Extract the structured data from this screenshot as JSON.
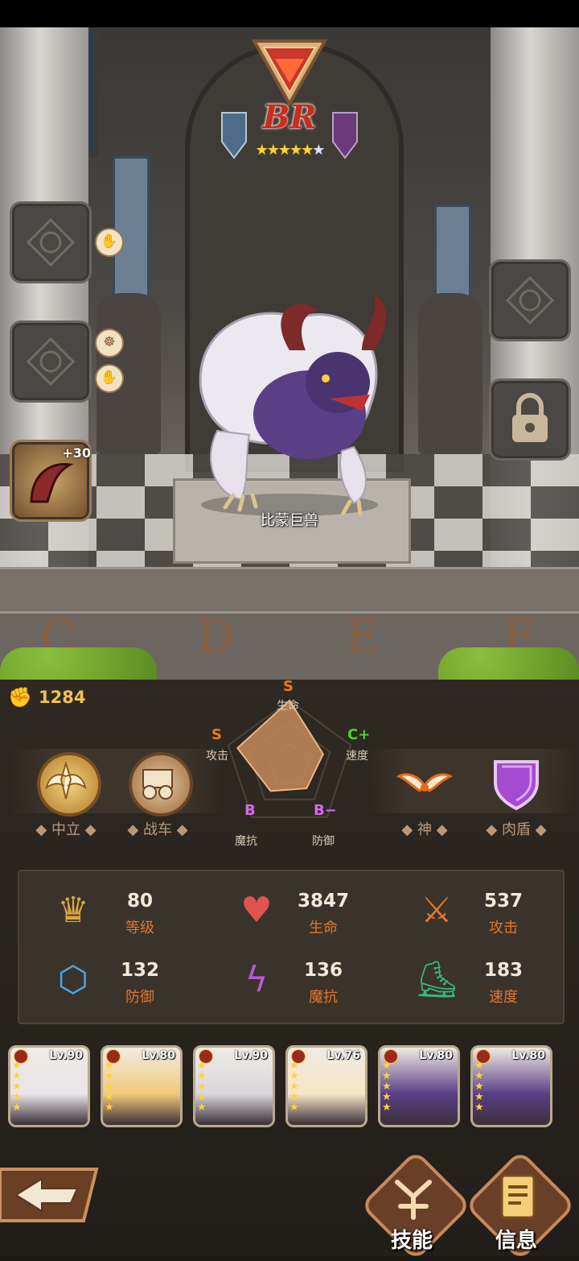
{
  "unit": {
    "rank": "BR",
    "stars_filled": 5,
    "stars_total": 6,
    "name": "比蒙巨兽",
    "buff_bonus": "+30",
    "power": "1284"
  },
  "floor_letters": [
    "C",
    "D",
    "E",
    "F"
  ],
  "traits": [
    {
      "label": "中立",
      "icon": "angel-wings-crest-icon"
    },
    {
      "label": "战车",
      "icon": "chariot-icon"
    },
    {
      "label": "神",
      "icon": "wings-icon"
    },
    {
      "label": "肉盾",
      "icon": "shield-icon"
    }
  ],
  "radar": {
    "axes": [
      {
        "label": "生命",
        "grade": "S",
        "color": "#f07a1c"
      },
      {
        "label": "速度",
        "grade": "C+",
        "color": "#4ed12e"
      },
      {
        "label": "防御",
        "grade": "B−",
        "color": "#d16be8"
      },
      {
        "label": "魔抗",
        "grade": "B",
        "color": "#d16be8"
      },
      {
        "label": "攻击",
        "grade": "S",
        "color": "#f07a1c"
      }
    ],
    "levels": [
      1.0,
      0.55,
      0.45,
      0.5,
      0.85
    ]
  },
  "stats": [
    {
      "value": "80",
      "label": "等级",
      "icon": "laurel-crown-icon"
    },
    {
      "value": "3847",
      "label": "生命",
      "icon": "heart-icon"
    },
    {
      "value": "537",
      "label": "攻击",
      "icon": "sword-icon"
    },
    {
      "value": "132",
      "label": "防御",
      "icon": "armor-icon"
    },
    {
      "value": "136",
      "label": "魔抗",
      "icon": "magic-shield-icon"
    },
    {
      "value": "183",
      "label": "速度",
      "icon": "boot-icon"
    }
  ],
  "roster": [
    {
      "level": "Lv.90",
      "portrait": "white-haired-girl"
    },
    {
      "level": "Lv.80",
      "portrait": "blonde-girl"
    },
    {
      "level": "Lv.90",
      "portrait": "masked-white-hair"
    },
    {
      "level": "Lv.76",
      "portrait": "fox-ear-girl"
    },
    {
      "level": "Lv.80",
      "portrait": "behemoth"
    },
    {
      "level": "Lv.80",
      "portrait": "behemoth"
    }
  ],
  "buttons": {
    "skill": "技能",
    "info": "信息"
  },
  "colors": {
    "accent_orange": "#e0772f",
    "gold": "#f2c24f",
    "panel": "#2a251f"
  }
}
